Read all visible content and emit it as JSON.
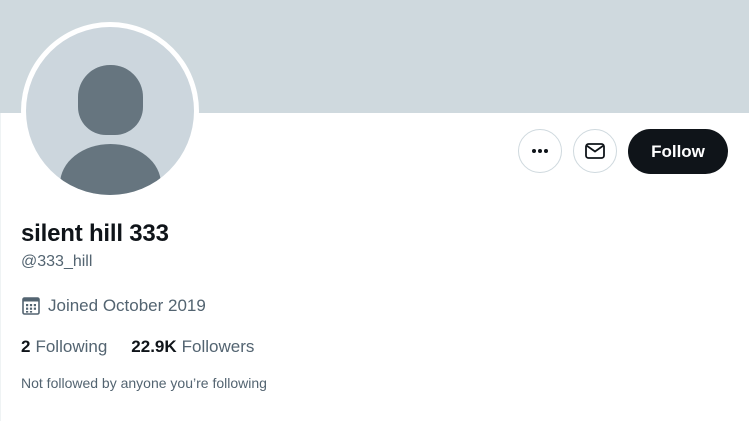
{
  "profile": {
    "display_name": "silent hill 333",
    "handle": "@333_hill",
    "joined": "Joined October 2019",
    "following_count": "2",
    "following_label": "Following",
    "followers_count": "22.9K",
    "followers_label": "Followers",
    "followed_by_note": "Not followed by anyone you’re following"
  },
  "actions": {
    "follow_label": "Follow",
    "more_icon": "more-icon",
    "message_icon": "mail-icon"
  },
  "colors": {
    "banner": "#cfd9de",
    "avatar_bg": "#ccd6dd",
    "avatar_figure": "#66757f",
    "follow_button": "#0f1419",
    "secondary_text": "#536471"
  }
}
